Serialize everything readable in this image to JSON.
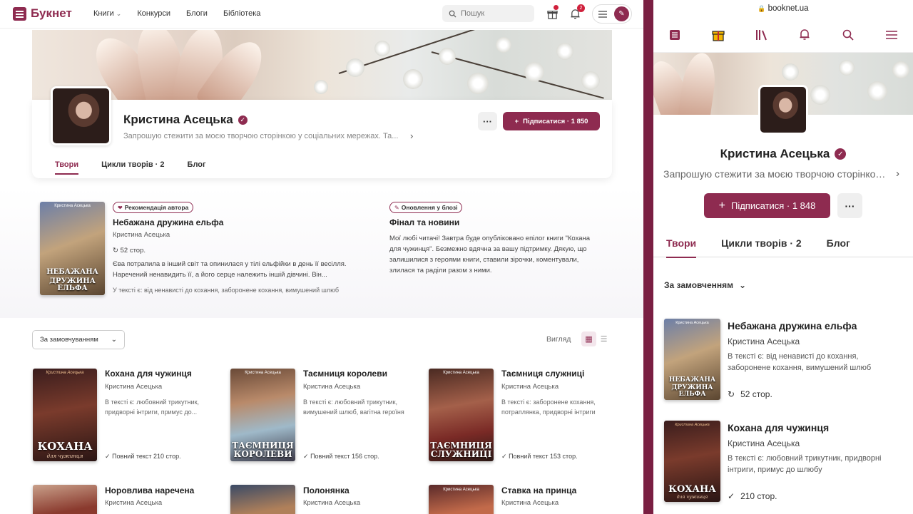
{
  "header": {
    "logo": "Букнет",
    "nav": [
      "Книги",
      "Конкурси",
      "Блоги",
      "Бібліотека"
    ],
    "search_placeholder": "Пошук",
    "notifications_count": "2"
  },
  "profile": {
    "name": "Кристина Асецька",
    "bio": "Запрошую стежити за моєю творчою сторінкою у соціальних мережах. Та...",
    "subscribe_label": "Підписатися · 1 850",
    "tabs": [
      "Твори",
      "Цикли творів · 2",
      "Блог"
    ]
  },
  "featured": {
    "badge": "Рекомендація автора",
    "cover_author": "Кристина Асецька",
    "cover_title_1": "НЕБАЖАНА",
    "cover_title_2": "ДРУЖИНА ЕЛЬФА",
    "title": "Небажана дружина ельфа",
    "author": "Кристина Асецька",
    "pages": "52 стор.",
    "description_1": "Єва потрапила в інший світ та опинилася у тілі ельфійки в день її весілля.",
    "description_2": "Наречений ненавидить її, а його серце належить іншій дівчині. Він...",
    "tags": "У тексті є: від ненависті до кохання, заборонене кохання, вимушений шлюб"
  },
  "blog": {
    "badge": "Оновлення у блозі",
    "title": "Фінал та новини",
    "text_1": "Мої любі читачі! Завтра буде опубліковано епілог книги \"Кохана",
    "text_2": "для чужинця\". Безмежно вдячна за вашу підтримку. Дякую, що",
    "text_3": "залишилися з героями книги, ставили зірочки, коментували,",
    "text_4": "злилася та раділи разом з ними."
  },
  "list": {
    "sort": "За замовчуванням",
    "view_label": "Вигляд",
    "books": [
      {
        "title": "Кохана для чужинця",
        "author": "Кристина Асецька",
        "tags_1": "В тексті є: любовний трикутник,",
        "tags_2": "придворні інтриги, примус до...",
        "pages": "Повний текст 210 стор.",
        "cover_title": "КОХАНА",
        "cover_sub": "для чужинця"
      },
      {
        "title": "Таємниця королеви",
        "author": "Кристина Асецька",
        "tags_1": "В тексті є: любовний трикутник,",
        "tags_2": "вимушений шлюб, вагітна героїня",
        "pages": "Повний текст 156 стор.",
        "cover_title": "ТАЄМНИЦЯ КОРОЛЕВИ",
        "cover_sub": ""
      },
      {
        "title": "Таємниця служниці",
        "author": "Кристина Асецька",
        "tags_1": "В тексті є: заборонене кохання,",
        "tags_2": "потраплянка, придворні інтриги",
        "pages": "Повний текст 153 стор.",
        "cover_title": "ТАЄМНИЦЯ СЛУЖНИЦІ",
        "cover_sub": ""
      },
      {
        "title": "Норовлива наречена",
        "author": "Кристина Асецька"
      },
      {
        "title": "Полонянка",
        "author": "Кристина Асецька"
      },
      {
        "title": "Ставка на принца",
        "author": "Кристина Асецька",
        "cover_author": "Кристина Асецька"
      }
    ]
  },
  "mobile": {
    "url": "booknet.ua",
    "name": "Кристина Асецька",
    "bio": "Запрошую стежити за моєю творчою сторінкою у соціальних мережах. Та...",
    "subscribe_label": "Підписатися · 1 848",
    "tabs": [
      "Твори",
      "Цикли творів · 2",
      "Блог"
    ],
    "sort": "За замовченням",
    "books": [
      {
        "title": "Небажана дружина ельфа",
        "author": "Кристина Асецька",
        "tags_1": "В тексті є: від ненависті до кохання,",
        "tags_2": "заборонене кохання, вимушений шлюб",
        "pages": "52 стор."
      },
      {
        "title": "Кохана для чужинця",
        "author": "Кристина Асецька",
        "tags_1": "В тексті є: любовний трикутник, придворні",
        "tags_2": "інтриги, примус до шлюбу",
        "pages": "210 стор."
      }
    ]
  },
  "colors": {
    "brand": "#8e2b50",
    "divider": "#7a1f42"
  }
}
